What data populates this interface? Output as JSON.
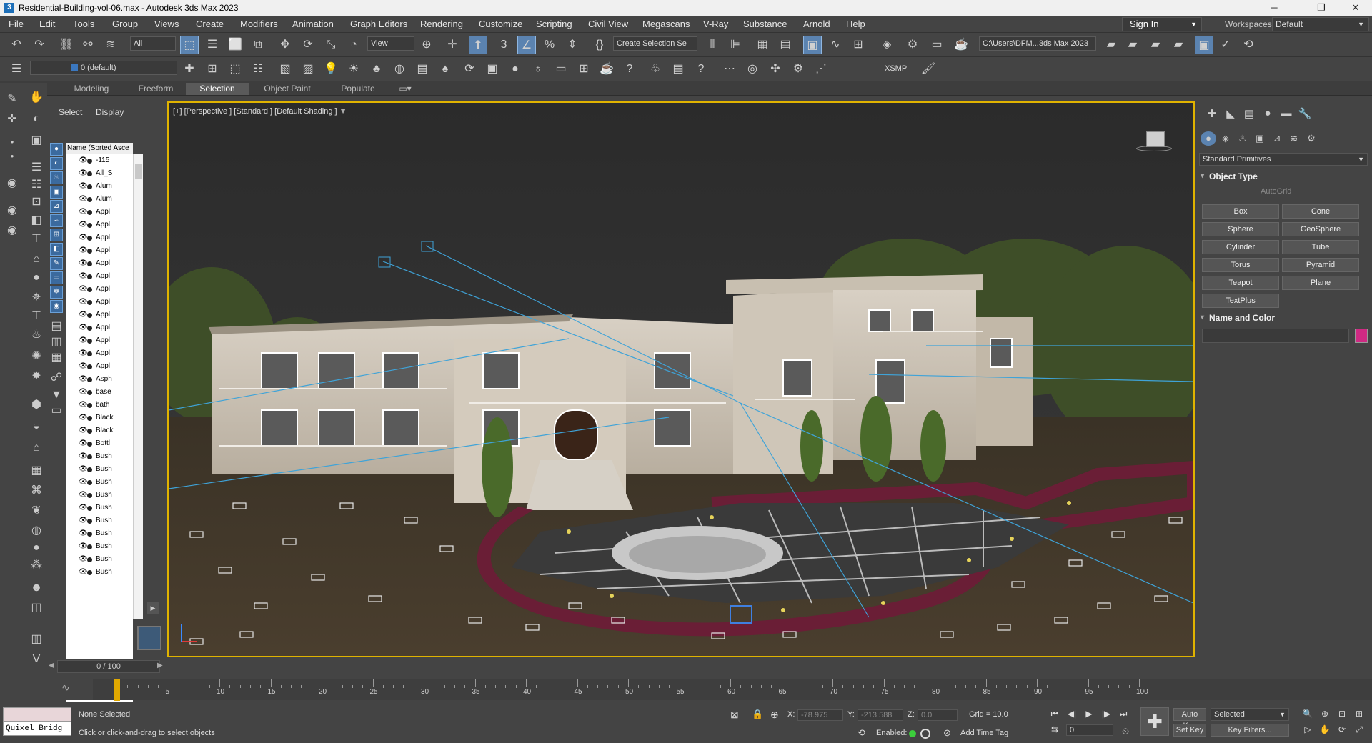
{
  "window": {
    "title": "Residential-Building-vol-06.max - Autodesk 3ds Max 2023",
    "minimize": "─",
    "maximize": "❐",
    "close": "✕"
  },
  "menu": [
    "File",
    "Edit",
    "Tools",
    "Group",
    "Views",
    "Create",
    "Modifiers",
    "Animation",
    "Graph Editors",
    "Rendering",
    "Customize",
    "Scripting",
    "Civil View",
    "Megascans",
    "V-Ray",
    "Substance",
    "Arnold",
    "Help"
  ],
  "account": {
    "sign_in": "Sign In",
    "workspaces_label": "Workspaces:",
    "workspace": "Default"
  },
  "toolbar1": {
    "selection_filter": "All",
    "ref_coord": "View",
    "named_selection": "Create Selection Se",
    "project_path": "C:\\Users\\DFM...3ds Max 2023"
  },
  "toolbar2": {
    "layer": "0 (default)",
    "xsmp": "XSMP"
  },
  "ribbon_tabs": [
    "Modeling",
    "Freeform",
    "Selection",
    "Object Paint",
    "Populate"
  ],
  "ribbon_selected": "Selection",
  "explorer": {
    "tabs": {
      "select": "Select",
      "display": "Display"
    },
    "column_header": "Name (Sorted Asce",
    "rows": [
      "-115",
      "All_S",
      "Alum",
      "Alum",
      "Appl",
      "Appl",
      "Appl",
      "Appl",
      "Appl",
      "Appl",
      "Appl",
      "Appl",
      "Appl",
      "Appl",
      "Appl",
      "Appl",
      "Appl",
      "Asph",
      "base",
      "bath",
      "Black",
      "Black",
      "Bottl",
      "Bush",
      "Bush",
      "Bush",
      "Bush",
      "Bush",
      "Bush",
      "Bush",
      "Bush",
      "Bush",
      "Bush"
    ]
  },
  "viewport": {
    "label": "[+] [Perspective ] [Standard ] [Default Shading ]"
  },
  "command_panel": {
    "category": "Standard Primitives",
    "object_type": "Object Type",
    "autogrid": "AutoGrid",
    "primitives": [
      "Box",
      "Cone",
      "Sphere",
      "GeoSphere",
      "Cylinder",
      "Tube",
      "Torus",
      "Pyramid",
      "Teapot",
      "Plane",
      "TextPlus"
    ],
    "name_and_color": "Name and Color",
    "object_color": "#cf2a83"
  },
  "timeline": {
    "frame_readout": "0 / 100",
    "ticks": [
      "0",
      "5",
      "10",
      "15",
      "20",
      "25",
      "30",
      "35",
      "40",
      "45",
      "50",
      "55",
      "60",
      "65",
      "70",
      "75",
      "80",
      "85",
      "90",
      "95",
      "100"
    ]
  },
  "status": {
    "script_listener": "Quixel Bridg",
    "selection": "None Selected",
    "prompt": "Click or click-and-drag to select objects",
    "x_label": "X:",
    "x_value": "-78.975",
    "y_label": "Y:",
    "y_value": "-213.588",
    "z_label": "Z:",
    "z_value": "0.0",
    "grid": "Grid = 10.0",
    "enabled": "Enabled:",
    "add_time_tag": "Add Time Tag",
    "auto_key": "Auto Key",
    "set_key": "Set Key",
    "key_mode": "Selected",
    "key_filters": "Key Filters...",
    "current_frame": "0"
  }
}
